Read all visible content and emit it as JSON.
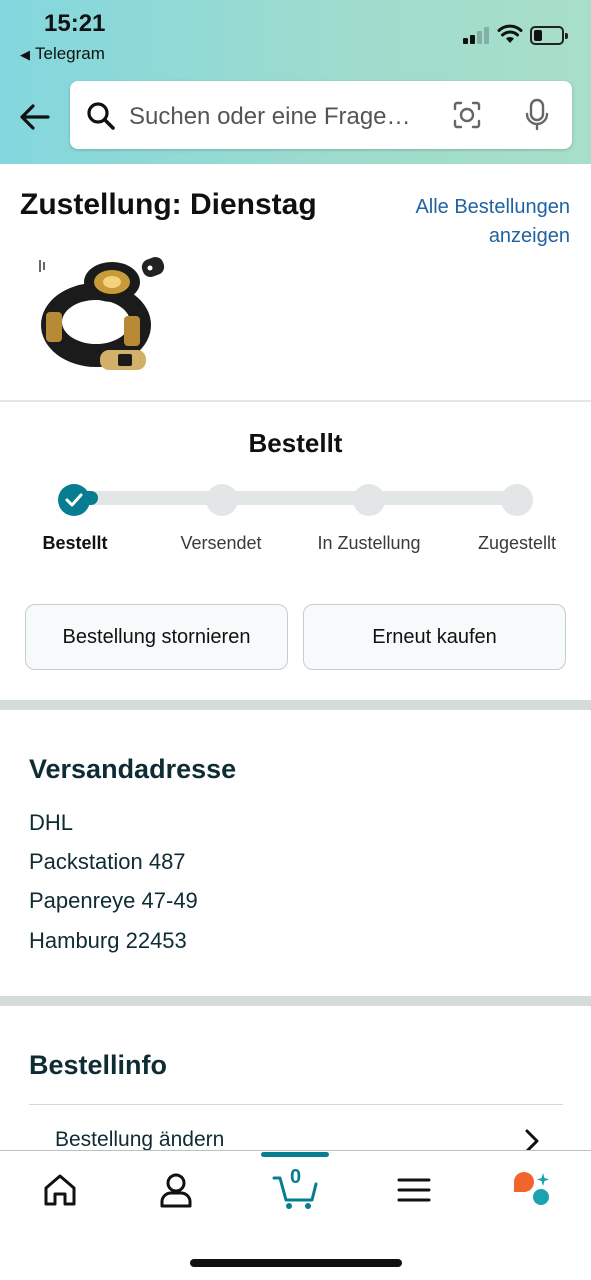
{
  "status_bar": {
    "time": "15:21",
    "back_app": "Telegram"
  },
  "search": {
    "placeholder": "Suchen oder eine Frage…"
  },
  "delivery": {
    "title": "Zustellung: Dienstag",
    "all_orders_link": "Alle Bestellungen anzeigen"
  },
  "tracking": {
    "heading": "Bestellt",
    "steps": [
      "Bestellt",
      "Versendet",
      "In Zustellung",
      "Zugestellt"
    ],
    "current_step": 1,
    "progress_fraction": 0.03
  },
  "actions": {
    "cancel_label": "Bestellung stornieren",
    "rebuy_label": "Erneut kaufen"
  },
  "shipping": {
    "heading": "Versandadresse",
    "lines": [
      "DHL",
      "Packstation 487",
      "Papenreye 47-49",
      "Hamburg 22453"
    ]
  },
  "order_info": {
    "heading": "Bestellinfo",
    "rows": [
      "Bestellung ändern"
    ]
  },
  "tabbar": {
    "cart_count": "0"
  },
  "colors": {
    "accent": "#067d90",
    "link": "#2162a1",
    "ai_orange": "#f2652a",
    "ai_teal": "#1aa2b1"
  }
}
